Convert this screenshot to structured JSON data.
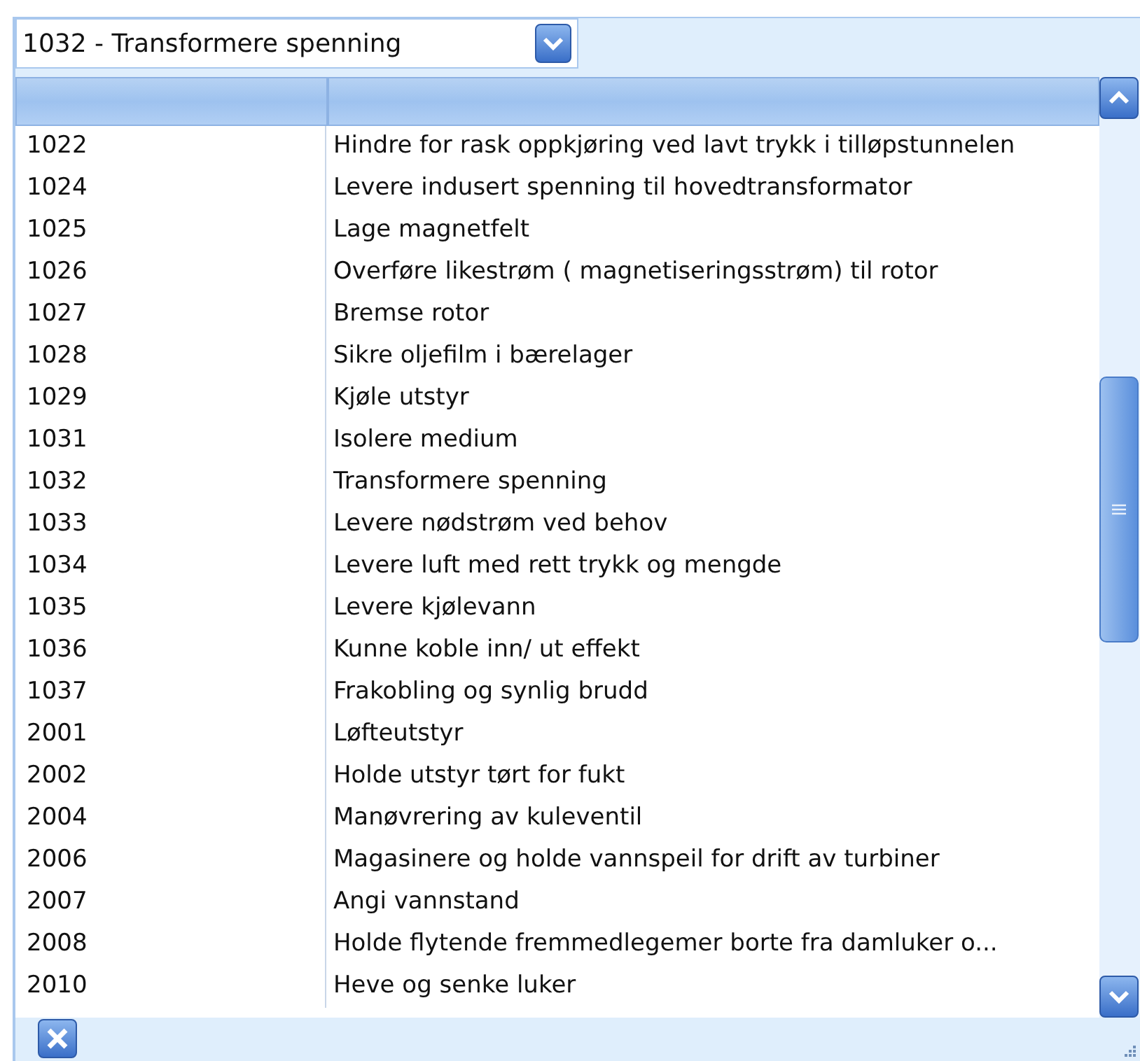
{
  "combo": {
    "value": "1032 - Transformere spenning"
  },
  "rows": [
    {
      "code": "1022",
      "text": "Hindre for rask oppkjøring ved lavt trykk i tilløpstunnelen"
    },
    {
      "code": "1024",
      "text": "Levere indusert spenning til hovedtransformator"
    },
    {
      "code": "1025",
      "text": "Lage magnetfelt"
    },
    {
      "code": "1026",
      "text": "Overføre likestrøm ( magnetiseringsstrøm) til rotor"
    },
    {
      "code": "1027",
      "text": "Bremse rotor"
    },
    {
      "code": "1028",
      "text": "Sikre oljefilm i bærelager"
    },
    {
      "code": "1029",
      "text": "Kjøle utstyr"
    },
    {
      "code": "1031",
      "text": "Isolere medium"
    },
    {
      "code": "1032",
      "text": "Transformere spenning"
    },
    {
      "code": "1033",
      "text": "Levere nødstrøm ved behov"
    },
    {
      "code": "1034",
      "text": "Levere luft med rett trykk og mengde"
    },
    {
      "code": "1035",
      "text": "Levere kjølevann"
    },
    {
      "code": "1036",
      "text": "Kunne koble inn/ ut effekt"
    },
    {
      "code": "1037",
      "text": "Frakobling og synlig brudd"
    },
    {
      "code": "2001",
      "text": "Løfteutstyr"
    },
    {
      "code": "2002",
      "text": "Holde utstyr tørt for fukt"
    },
    {
      "code": "2004",
      "text": "Manøvrering av kuleventil"
    },
    {
      "code": "2006",
      "text": "Magasinere og holde vannspeil for drift av turbiner"
    },
    {
      "code": "2007",
      "text": "Angi vannstand"
    },
    {
      "code": "2008",
      "text": "Holde flytende fremmedlegemer borte fra damluker o..."
    },
    {
      "code": "2010",
      "text": "Heve og senke luker"
    }
  ]
}
